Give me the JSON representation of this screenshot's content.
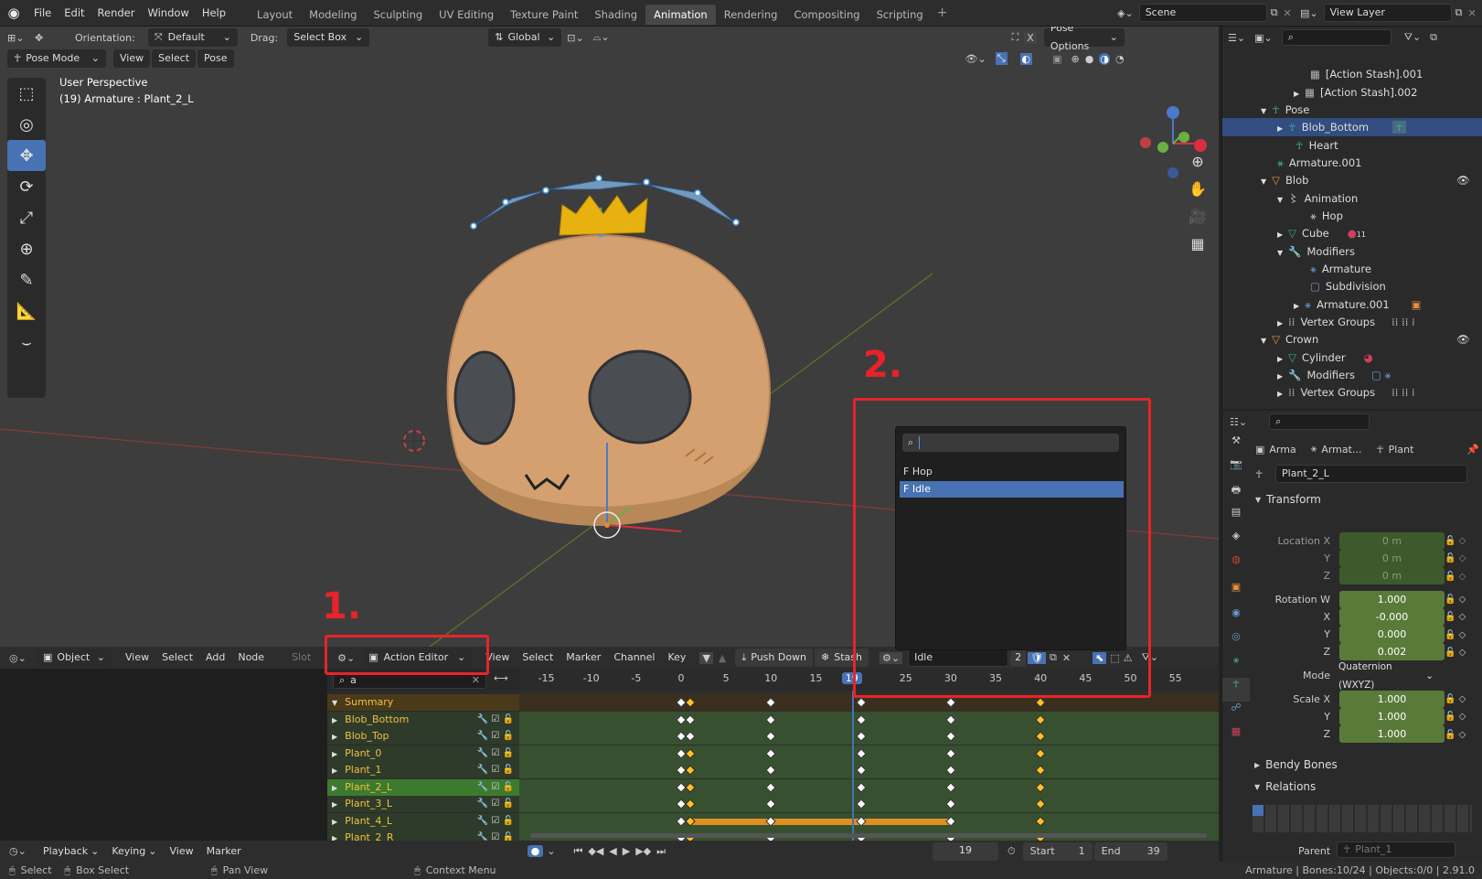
{
  "top_menu": [
    "File",
    "Edit",
    "Render",
    "Window",
    "Help"
  ],
  "workspace_tabs": [
    "Layout",
    "Modeling",
    "Sculpting",
    "UV Editing",
    "Texture Paint",
    "Shading",
    "Animation",
    "Rendering",
    "Compositing",
    "Scripting"
  ],
  "active_workspace": "Animation",
  "scene": {
    "name": "Scene",
    "view_layer": "View Layer"
  },
  "viewport": {
    "orientation_label": "Orientation:",
    "orientation": "Default",
    "drag_label": "Drag:",
    "drag": "Select Box",
    "transform_space": "Global",
    "pose_options": "Pose Options",
    "mode": "Pose Mode",
    "menus": [
      "View",
      "Select",
      "Pose"
    ],
    "overlay_title": "User Perspective",
    "overlay_subtitle": "(19) Armature : Plant_2_L"
  },
  "outliner": {
    "search": "",
    "rows": [
      {
        "label": "[Action Stash].001",
        "icon": "action-icon"
      },
      {
        "label": "[Action Stash].002",
        "icon": "action-icon"
      },
      {
        "label": "Pose",
        "icon": "pose-icon"
      },
      {
        "label": "Blob_Bottom",
        "icon": "bone-icon",
        "selected": true
      },
      {
        "label": "Heart",
        "icon": "bone-icon"
      },
      {
        "label": "Armature.001",
        "icon": "armature-icon"
      },
      {
        "label": "Blob",
        "icon": "mesh-object-icon"
      },
      {
        "label": "Animation",
        "icon": "animation-icon"
      },
      {
        "label": "Hop",
        "icon": "action-icon"
      },
      {
        "label": "Cube",
        "icon": "mesh-data-icon"
      },
      {
        "label": "Modifiers",
        "icon": "wrench-icon"
      },
      {
        "label": "Armature",
        "icon": "armature-modifier-icon"
      },
      {
        "label": "Subdivision",
        "icon": "subdivision-icon"
      },
      {
        "label": "Armature.001",
        "icon": "armature-modifier-icon"
      },
      {
        "label": "Vertex Groups",
        "icon": "vertex-groups-icon"
      },
      {
        "label": "Crown",
        "icon": "mesh-object-icon"
      },
      {
        "label": "Cylinder",
        "icon": "mesh-data-icon"
      },
      {
        "label": "Modifiers",
        "icon": "wrench-icon"
      },
      {
        "label": "Vertex Groups",
        "icon": "vertex-groups-icon"
      }
    ],
    "cube_badge": "11"
  },
  "properties": {
    "breadcrumb": [
      "Arma",
      "Armat...",
      "Plant"
    ],
    "bone_name": "Plant_2_L",
    "transform_header": "Transform",
    "location_label": "Location X",
    "location": [
      "0 m",
      "0 m",
      "0 m"
    ],
    "rotation_label": "Rotation W",
    "rotation": [
      "1.000",
      "-0.000",
      "0.000",
      "0.002"
    ],
    "mode_label": "Mode",
    "mode": "Quaternion (WXYZ)",
    "scale_label": "Scale X",
    "scale": [
      "1.000",
      "1.000",
      "1.000"
    ],
    "axis_labels": [
      "X",
      "Y",
      "Z"
    ],
    "bendy_bones": "Bendy Bones",
    "relations": "Relations",
    "parent_label": "Parent",
    "parent": "Plant_1"
  },
  "dopesheet": {
    "editor_mode": "Object",
    "left_menus": [
      "View",
      "Select",
      "Add",
      "Node"
    ],
    "slot_label": "Slot",
    "action_editor": "Action Editor",
    "menus": [
      "View",
      "Select",
      "Marker",
      "Channel",
      "Key"
    ],
    "push_down": "Push Down",
    "stash": "Stash",
    "action_name": "Idle",
    "users": "2",
    "search": "a",
    "ruler": [
      "-15",
      "-10",
      "-5",
      "0",
      "5",
      "10",
      "15",
      "19",
      "25",
      "30",
      "35",
      "40",
      "45",
      "50",
      "55"
    ],
    "current_frame": "19",
    "channels": [
      "Summary",
      "Blob_Bottom",
      "Blob_Top",
      "Plant_0",
      "Plant_1",
      "Plant_2_L",
      "Plant_3_L",
      "Plant_4_L",
      "Plant_2_R"
    ]
  },
  "action_dropdown": {
    "search": "",
    "items": [
      {
        "label": "F Hop"
      },
      {
        "label": "F Idle",
        "selected": true
      }
    ]
  },
  "annotations": {
    "one": "1.",
    "two": "2."
  },
  "timeline": {
    "menus": [
      "Playback",
      "Keying",
      "View",
      "Marker"
    ],
    "frame": "19",
    "start_label": "Start",
    "start": "1",
    "end_label": "End",
    "end": "39"
  },
  "status": {
    "select": "Select",
    "box_select": "Box Select",
    "pan_view": "Pan View",
    "context_menu": "Context Menu",
    "info": "Armature | Bones:10/24 | Objects:0/0 | 2.91.0"
  }
}
